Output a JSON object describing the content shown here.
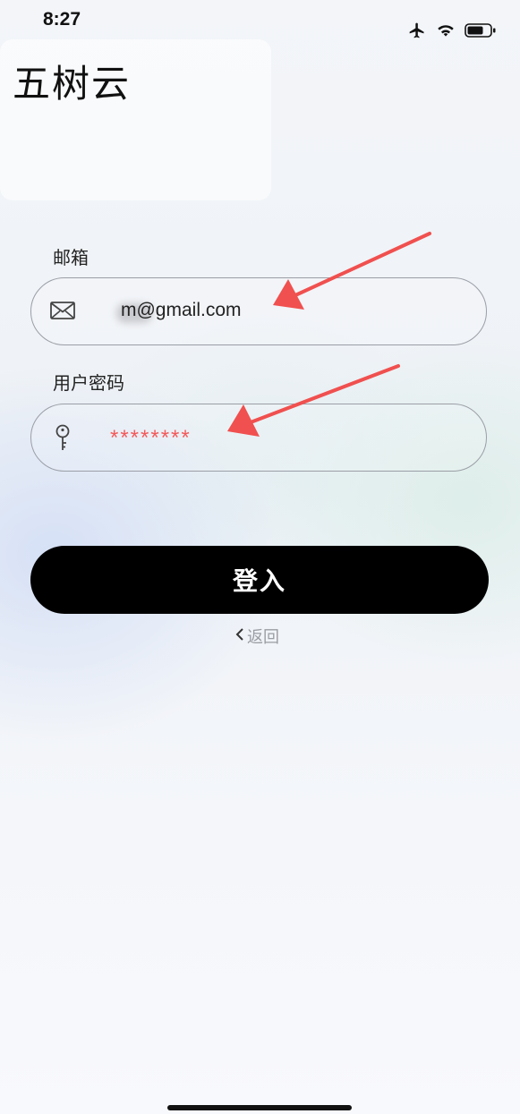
{
  "status_bar": {
    "time": "8:27",
    "icons": [
      "airplane-icon",
      "wifi-icon",
      "battery-icon"
    ]
  },
  "brand": {
    "title": "五树云",
    "subtitle_blurred": ""
  },
  "email": {
    "label": "邮箱",
    "icon": "mail-icon",
    "value": "m@gmail.com"
  },
  "password": {
    "label": "用户密码",
    "icon": "key-icon",
    "value": "********"
  },
  "login_button": {
    "label": "登入"
  },
  "back_link": {
    "label": "返回",
    "icon": "chevron-left-icon"
  },
  "colors": {
    "annotation_arrow": "#f0504f",
    "button_bg": "#000000",
    "password_text": "#f25a5a"
  }
}
